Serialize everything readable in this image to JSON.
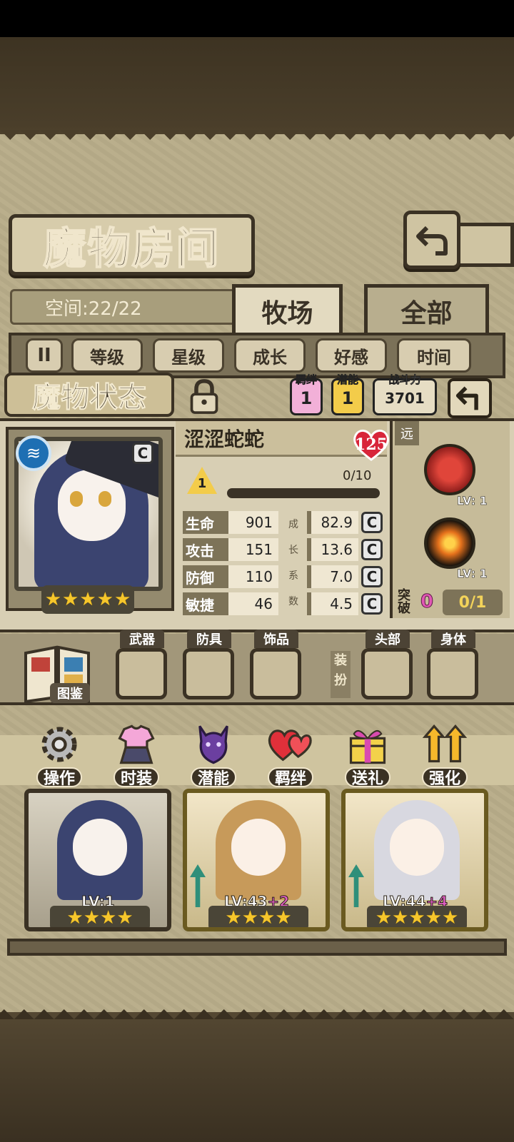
{
  "room": {
    "title": "魔物房间",
    "space_text": "空间:22/22",
    "tabs": [
      "牧场",
      "全部"
    ],
    "sort_buttons": [
      "等级",
      "星级",
      "成长",
      "好感",
      "时间"
    ],
    "pause_label": "II"
  },
  "status": {
    "label": "魔物状态",
    "bond_label": "羁绊",
    "bond_value": "1",
    "potential_label": "潜能",
    "potential_value": "1",
    "power_label": "战斗力",
    "power_value": "3701"
  },
  "monster": {
    "name": "涩涩蛇蛇",
    "affection": "125",
    "grade": "C",
    "level_badge": "1",
    "exp_text": "0/10",
    "exp_fraction": 0.0,
    "stars": 5,
    "element_icon": "water-wave-icon",
    "stats": [
      {
        "name": "生命",
        "value": "901",
        "growth": "82.9",
        "grade": "C"
      },
      {
        "name": "攻击",
        "value": "151",
        "growth": "13.6",
        "grade": "C"
      },
      {
        "name": "防御",
        "value": "110",
        "growth": "7.0",
        "grade": "C"
      },
      {
        "name": "敏捷",
        "value": "46",
        "growth": "4.5",
        "grade": "C"
      }
    ],
    "growth_label_chars": [
      "成",
      "长",
      "系",
      "数"
    ],
    "range_tag": "远",
    "skills": [
      {
        "icon": "red-serpent-skill-icon",
        "level": "LV: 1"
      },
      {
        "icon": "fire-burst-skill-icon",
        "level": "LV: 1"
      }
    ],
    "breakthrough_label": "突破",
    "breakthrough_value": "0",
    "breakthrough_progress": "0/1"
  },
  "equipment": {
    "book_label": "图鉴",
    "slots": [
      "武器",
      "防具",
      "饰品",
      "头部",
      "身体"
    ],
    "divider_label": "装扮"
  },
  "actions": [
    "操作",
    "时装",
    "潜能",
    "羁绊",
    "送礼",
    "强化"
  ],
  "cards": [
    {
      "level": "LV:1",
      "plus": "",
      "stars": 4
    },
    {
      "level": "LV:43",
      "plus": "+2",
      "stars": 4
    },
    {
      "level": "LV:44",
      "plus": "+4",
      "stars": 5
    }
  ],
  "colors": {
    "parchment": "#b9ad8a",
    "frame": "#3b3224",
    "accent_gold": "#f6c62b",
    "accent_pink": "#e257b5"
  }
}
